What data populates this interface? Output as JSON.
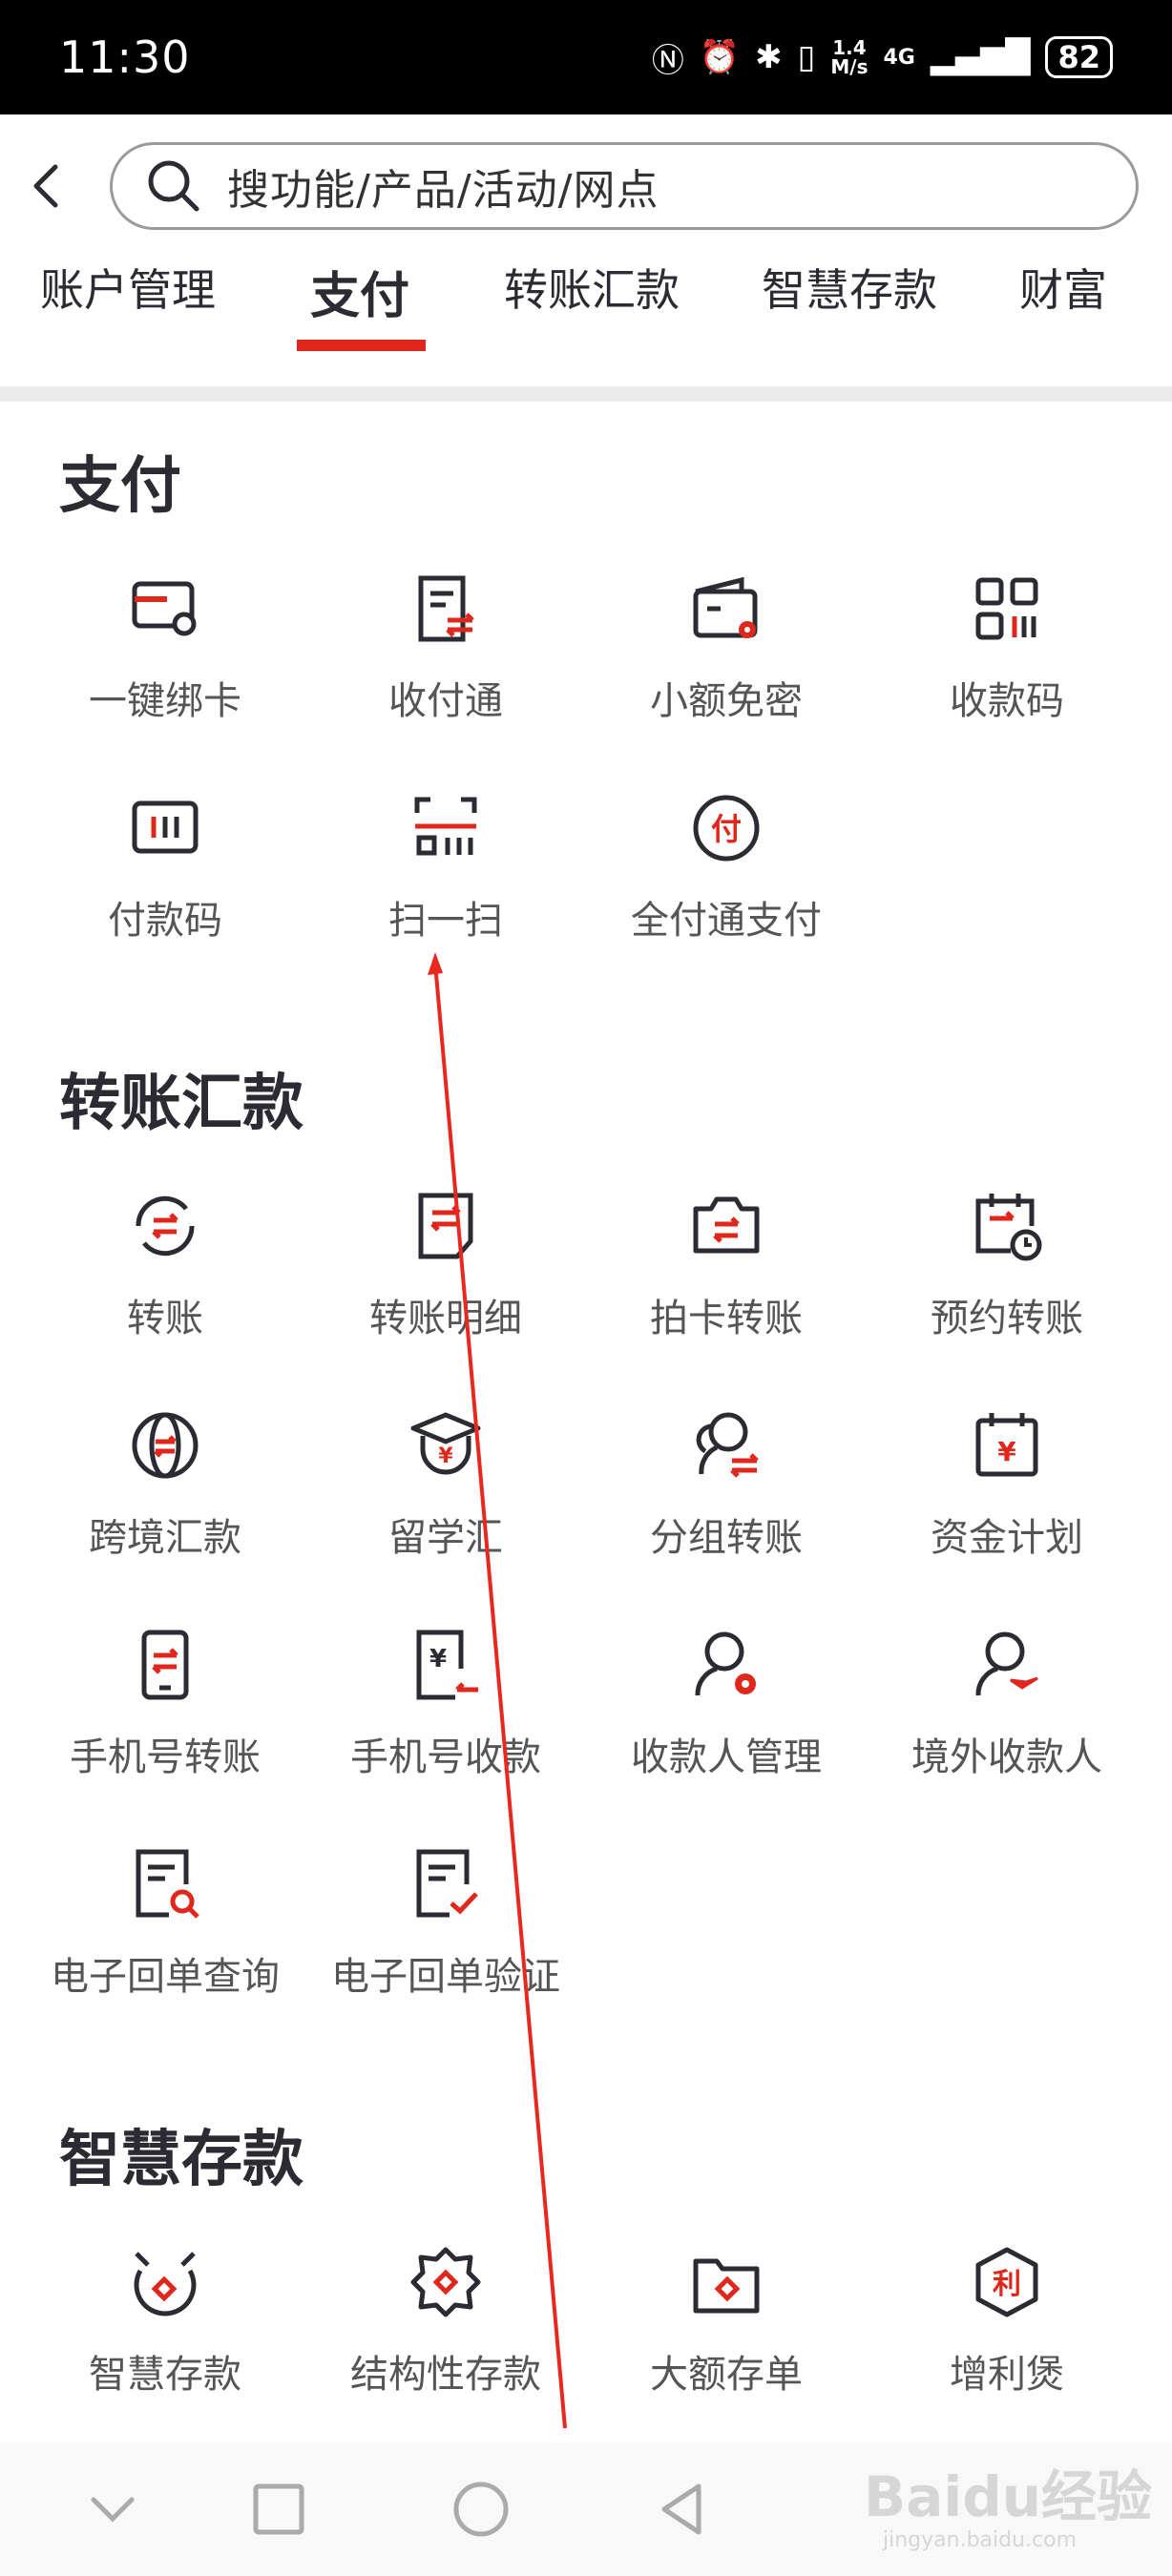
{
  "status_bar": {
    "time": "11:30",
    "speed_top": "1.4",
    "speed_bottom": "M/s",
    "network": "4G",
    "battery": "82"
  },
  "search": {
    "placeholder": "搜功能/产品/活动/网点"
  },
  "tabs": [
    {
      "label": "账户管理"
    },
    {
      "label": "支付"
    },
    {
      "label": "转账汇款"
    },
    {
      "label": "智慧存款"
    },
    {
      "label": "财富"
    }
  ],
  "active_tab": "支付",
  "colors": {
    "accent": "#e0271c",
    "icon_dark": "#2b2b33",
    "icon_red": "#e0271c"
  },
  "sections": [
    {
      "title": "支付",
      "items": [
        {
          "label": "一键绑卡",
          "icon": "card-link-icon"
        },
        {
          "label": "收付通",
          "icon": "doc-transfer-icon"
        },
        {
          "label": "小额免密",
          "icon": "wallet-settings-icon"
        },
        {
          "label": "收款码",
          "icon": "qr-code-icon"
        },
        {
          "label": "付款码",
          "icon": "barcode-icon"
        },
        {
          "label": "扫一扫",
          "icon": "scan-icon"
        },
        {
          "label": "全付通支付",
          "icon": "pay-circle-icon"
        }
      ]
    },
    {
      "title": "转账汇款",
      "items": [
        {
          "label": "转账",
          "icon": "transfer-cycle-icon"
        },
        {
          "label": "转账明细",
          "icon": "transfer-detail-icon"
        },
        {
          "label": "拍卡转账",
          "icon": "camera-card-icon"
        },
        {
          "label": "预约转账",
          "icon": "calendar-clock-icon"
        },
        {
          "label": "跨境汇款",
          "icon": "globe-transfer-icon"
        },
        {
          "label": "留学汇",
          "icon": "graduate-icon"
        },
        {
          "label": "分组转账",
          "icon": "group-transfer-icon"
        },
        {
          "label": "资金计划",
          "icon": "calendar-yuan-icon"
        },
        {
          "label": "手机号转账",
          "icon": "phone-transfer-icon"
        },
        {
          "label": "手机号收款",
          "icon": "phone-receive-icon"
        },
        {
          "label": "收款人管理",
          "icon": "payee-settings-icon"
        },
        {
          "label": "境外收款人",
          "icon": "overseas-payee-icon"
        },
        {
          "label": "电子回单查询",
          "icon": "receipt-search-icon"
        },
        {
          "label": "电子回单验证",
          "icon": "receipt-verify-icon"
        }
      ]
    },
    {
      "title": "智慧存款",
      "items": [
        {
          "label": "智慧存款",
          "icon": "smart-deposit-icon"
        },
        {
          "label": "结构性存款",
          "icon": "structured-deposit-icon"
        },
        {
          "label": "大额存单",
          "icon": "large-deposit-icon"
        },
        {
          "label": "增利煲",
          "icon": "interest-badge-icon",
          "badge": "利"
        }
      ]
    }
  ],
  "watermark": {
    "text": "Baidu经验",
    "sub": "jingyan.baidu.com"
  }
}
